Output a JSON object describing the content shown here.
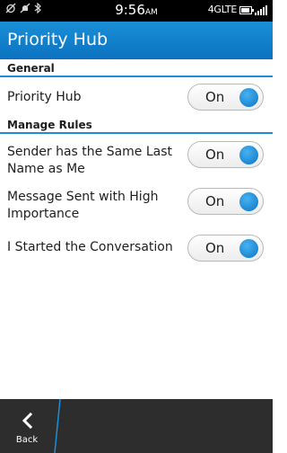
{
  "status_bar": {
    "time": "9:56",
    "time_suffix": "AM",
    "network": "4GLTE"
  },
  "header": {
    "title": "Priority Hub"
  },
  "sections": {
    "general": "General",
    "manage_rules": "Manage Rules"
  },
  "rows": [
    {
      "label": "Priority Hub",
      "toggle": "On",
      "on": true
    },
    {
      "label": "Sender has the Same Last Name as Me",
      "toggle": "On",
      "on": true
    },
    {
      "label": "Message Sent with High Importance",
      "toggle": "On",
      "on": true
    },
    {
      "label": "I Started the Conversation",
      "toggle": "On",
      "on": true
    }
  ],
  "footer": {
    "back_label": "Back"
  },
  "colors": {
    "accent": "#1a8fd8",
    "toggle_knob": "#0b76c6",
    "bottom_bar": "#2d2d2d"
  },
  "icons": {
    "status_left": [
      "alarm-off-icon",
      "notifications-muted-icon",
      "bluetooth-icon"
    ],
    "status_right": [
      "battery-icon",
      "signal-bars-icon"
    ],
    "back": "back-chevron-icon"
  }
}
